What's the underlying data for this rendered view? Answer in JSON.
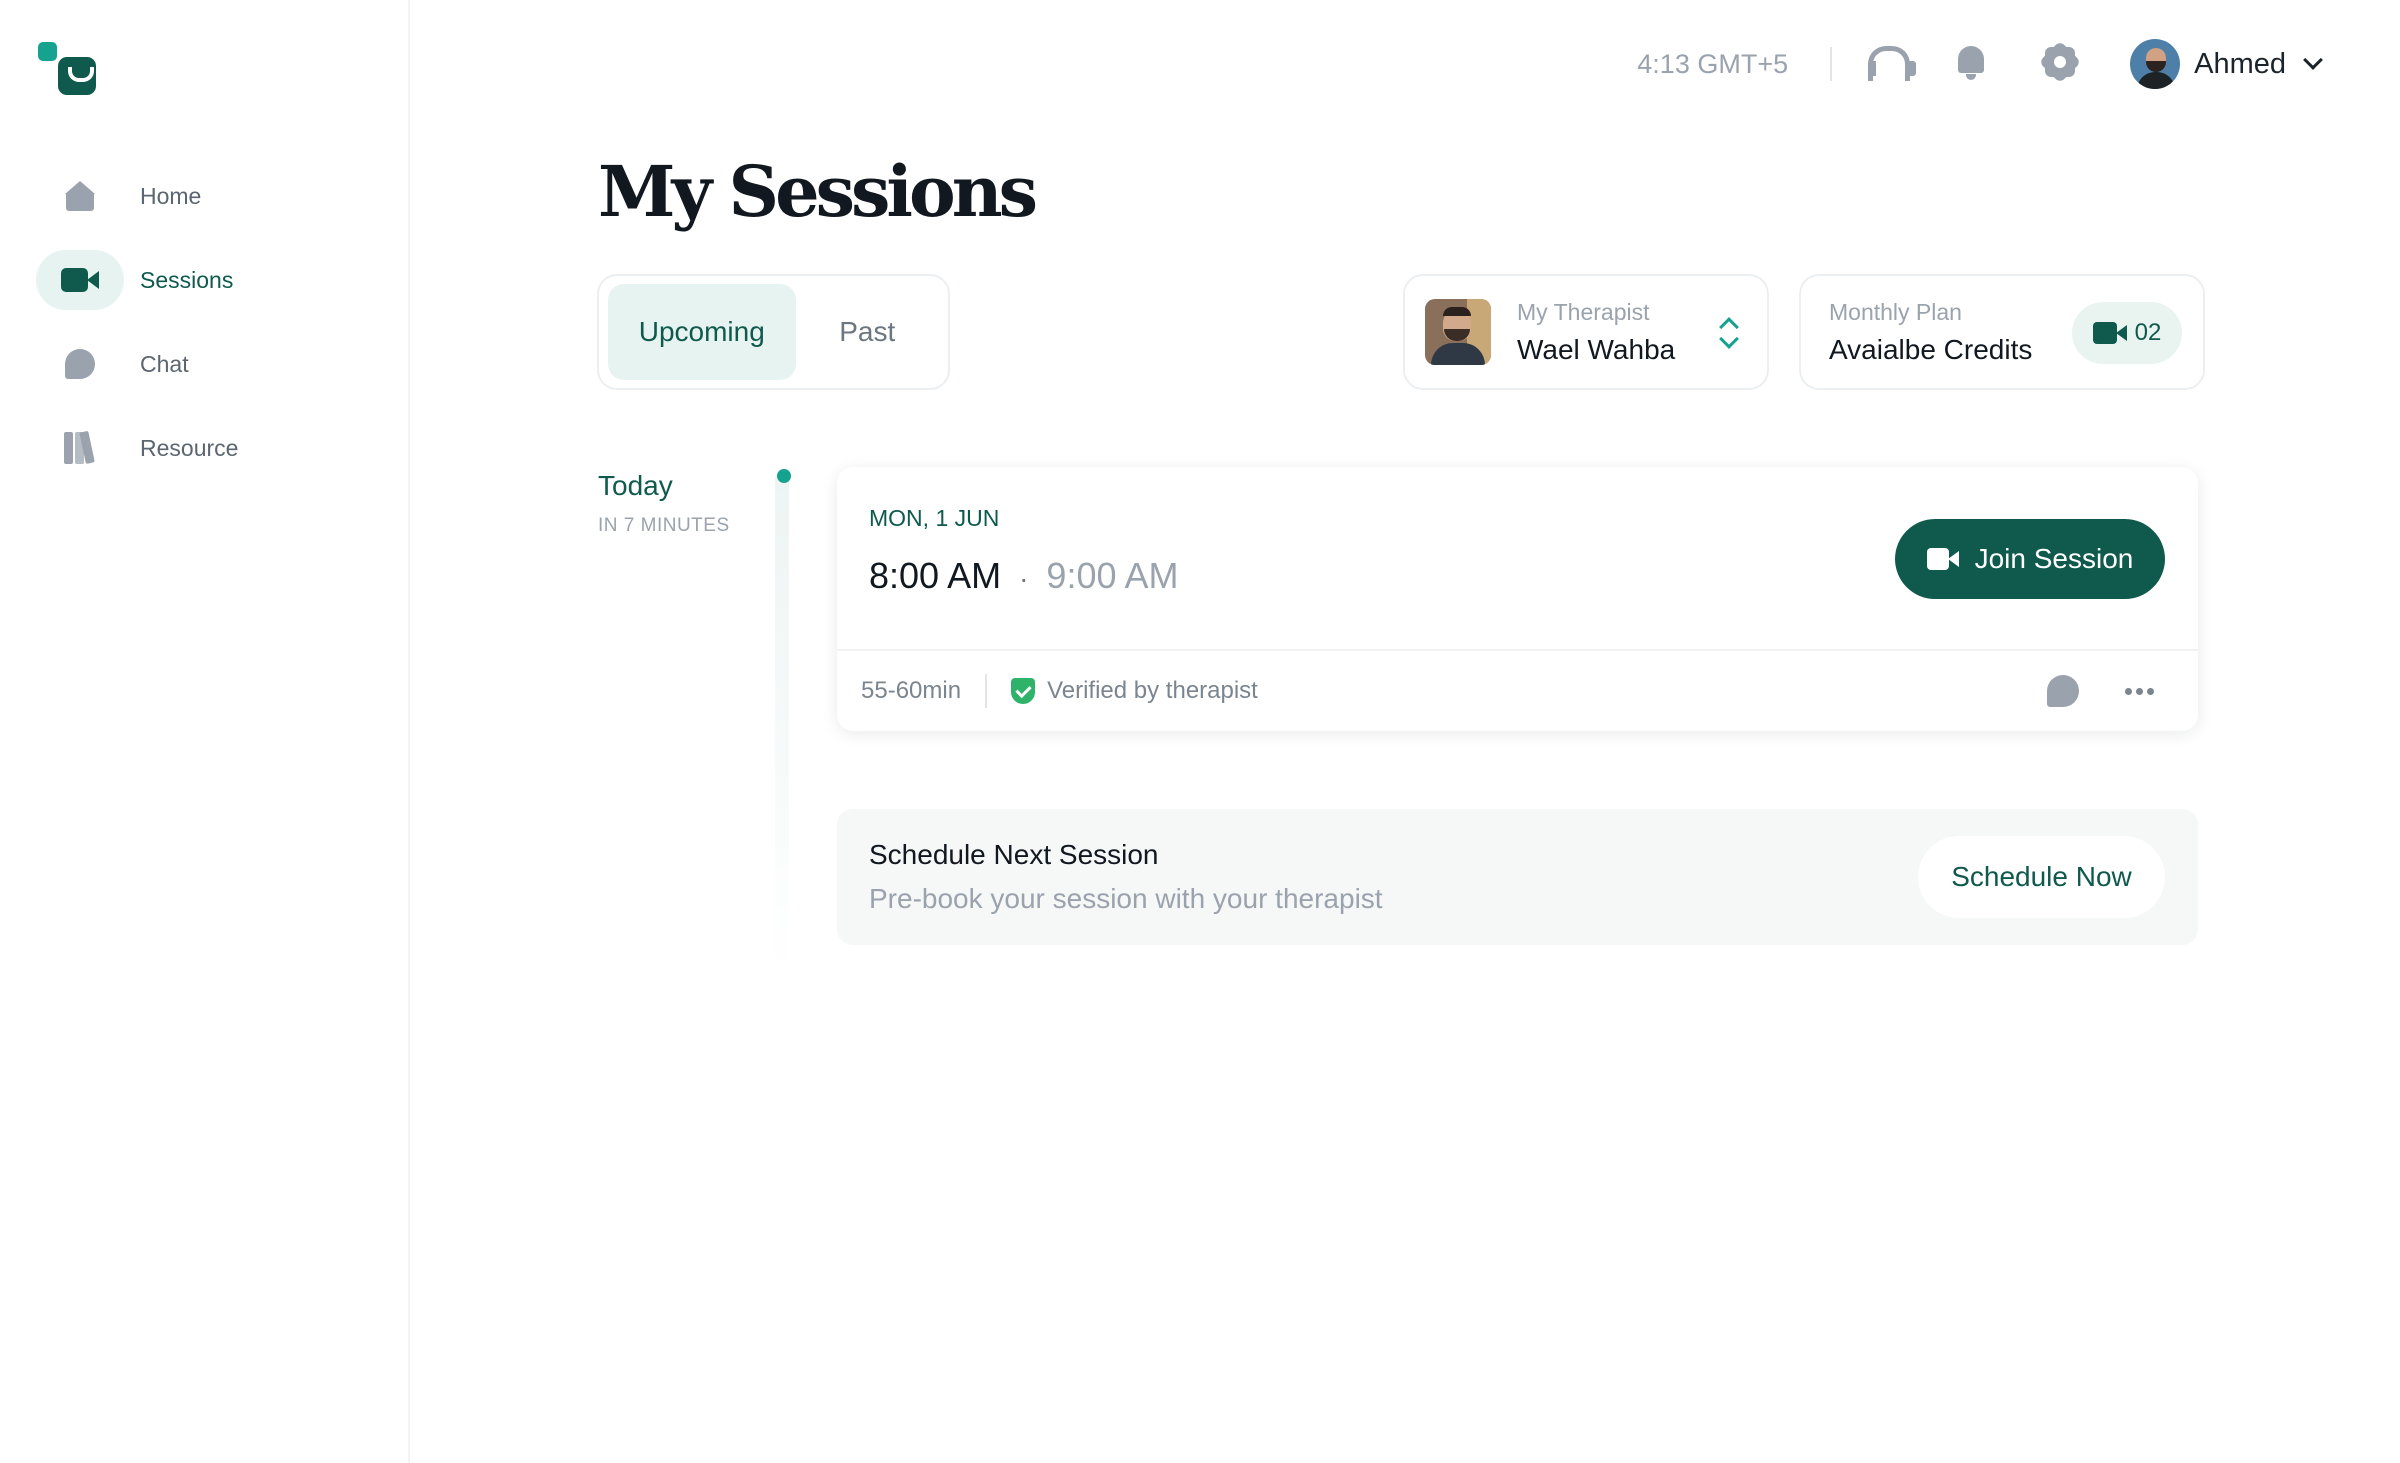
{
  "sidebar": {
    "items": [
      {
        "label": "Home",
        "icon": "home-icon"
      },
      {
        "label": "Sessions",
        "icon": "video-camera-icon",
        "active": true
      },
      {
        "label": "Chat",
        "icon": "chat-bubble-icon"
      },
      {
        "label": "Resource",
        "icon": "books-icon"
      }
    ]
  },
  "topbar": {
    "time": "4:13 GMT+5",
    "icons": [
      "headphones-icon",
      "bell-icon",
      "gear-icon"
    ],
    "user_name": "Ahmed"
  },
  "page": {
    "title": "My Sessions"
  },
  "tabs": [
    {
      "label": "Upcoming",
      "active": true
    },
    {
      "label": "Past",
      "active": false
    }
  ],
  "therapist": {
    "caption": "My Therapist",
    "name": "Wael Wahba"
  },
  "plan": {
    "caption": "Monthly Plan",
    "title": "Avaialbe Credits",
    "credits": "02"
  },
  "timeline": {
    "day": "Today",
    "relative": "IN 7 MINUTES"
  },
  "session": {
    "date": "MON, 1 JUN",
    "start": "8:00 AM",
    "separator": "·",
    "end": "9:00 AM",
    "join_label": "Join Session",
    "duration": "55-60min",
    "verified": "Verified by therapist"
  },
  "schedule": {
    "title": "Schedule Next Session",
    "subtitle": "Pre-book your session with your therapist",
    "button": "Schedule Now"
  },
  "colors": {
    "brand": "#0f5a4d",
    "accent": "#15a28e",
    "active_bg": "#e7f3f0",
    "muted": "#9aa3ad",
    "verified": "#2fb36b"
  }
}
